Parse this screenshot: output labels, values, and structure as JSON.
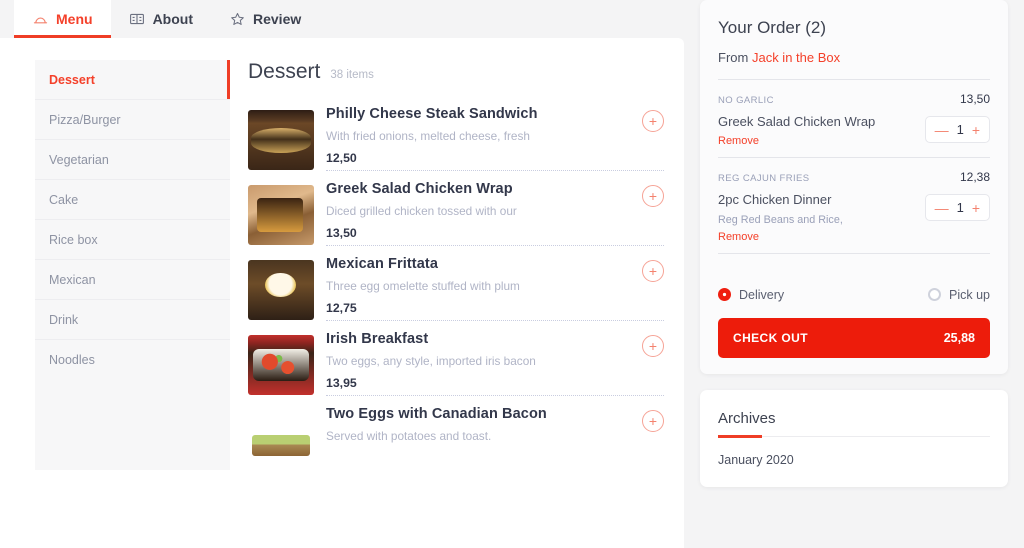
{
  "tabs": [
    {
      "label": "Menu",
      "icon": "cloche-icon",
      "active": true
    },
    {
      "label": "About",
      "icon": "panels-icon",
      "active": false
    },
    {
      "label": "Review",
      "icon": "star-icon",
      "active": false
    }
  ],
  "categories": [
    {
      "label": "Dessert",
      "active": true
    },
    {
      "label": "Pizza/Burger",
      "active": false
    },
    {
      "label": "Vegetarian",
      "active": false
    },
    {
      "label": "Cake",
      "active": false
    },
    {
      "label": "Rice box",
      "active": false
    },
    {
      "label": "Mexican",
      "active": false
    },
    {
      "label": "Drink",
      "active": false
    },
    {
      "label": "Noodles",
      "active": false
    }
  ],
  "menu": {
    "title": "Dessert",
    "count": "38 items",
    "add_glyph": "+",
    "items": [
      {
        "name": "Philly Cheese Steak Sandwich",
        "desc": "With fried onions, melted cheese, fresh",
        "price": "12,50"
      },
      {
        "name": "Greek Salad Chicken Wrap",
        "desc": "Diced grilled chicken tossed with our",
        "price": "13,50"
      },
      {
        "name": "Mexican Frittata",
        "desc": "Three egg omelette stuffed with plum",
        "price": "12,75"
      },
      {
        "name": "Irish Breakfast",
        "desc": "Two eggs, any style, imported iris bacon",
        "price": "13,95"
      },
      {
        "name": "Two Eggs with Canadian Bacon",
        "desc": "Served with potatoes and toast.",
        "price": ""
      }
    ]
  },
  "order": {
    "title": "Your Order (2)",
    "from_label": "From",
    "restaurant": "Jack in the Box",
    "minus_glyph": "—",
    "plus_glyph": "+",
    "items": [
      {
        "option": "NO GARLIC",
        "price": "13,50",
        "name": "Greek Salad Chicken Wrap",
        "sub": "",
        "remove_label": "Remove",
        "qty": "1"
      },
      {
        "option": "REG CAJUN FRIES",
        "price": "12,38",
        "name": "2pc Chicken Dinner",
        "sub": "Reg Red Beans and Rice,",
        "remove_label": "Remove",
        "qty": "1"
      }
    ],
    "delivery_label": "Delivery",
    "pickup_label": "Pick up",
    "delivery_selected": true,
    "checkout_label": "CHECK OUT",
    "total": "25,88"
  },
  "archives": {
    "title": "Archives",
    "items": [
      "January 2020"
    ]
  },
  "colors": {
    "accent_red": "#ef3d26",
    "checkout_red": "#ed1c0b",
    "coral": "#f4826e",
    "muted_text": "#b0b4c6",
    "dark_text": "#32374a"
  }
}
